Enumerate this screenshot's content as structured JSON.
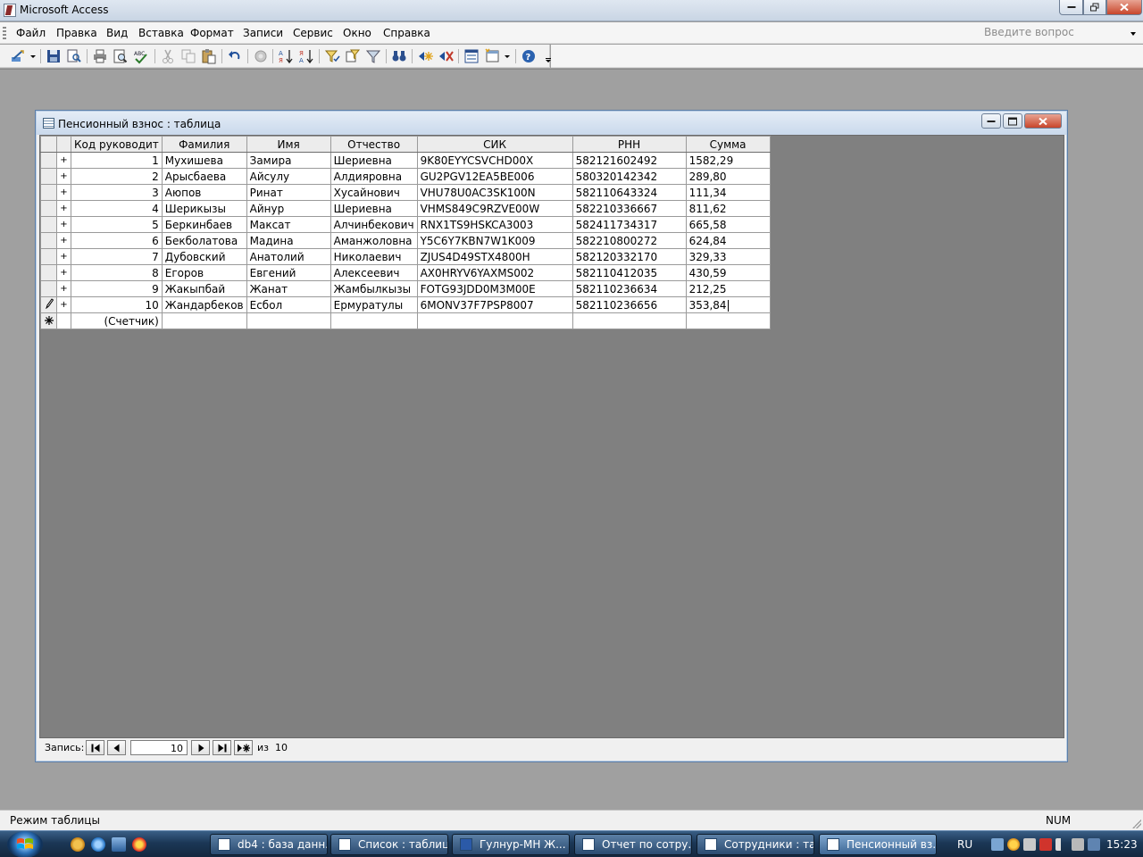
{
  "window": {
    "title": "Microsoft Access"
  },
  "menu": {
    "items": [
      "Файл",
      "Правка",
      "Вид",
      "Вставка",
      "Формат",
      "Записи",
      "Сервис",
      "Окно",
      "Справка"
    ],
    "ask_placeholder": "Введите вопрос"
  },
  "table_window": {
    "title": "Пенсионный взнос : таблица",
    "columns": [
      "Код руководит",
      "Фамилия",
      "Имя",
      "Отчество",
      "СИК",
      "РНН",
      "Сумма"
    ],
    "rows": [
      [
        "1",
        "Мухишева",
        "Замира",
        "Шериевна",
        "9K80EYYCSVCHD00X",
        "582121602492",
        "1582,29"
      ],
      [
        "2",
        "Арысбаева",
        "Айсулу",
        "Алдияровна",
        "GU2PGV12EA5BE006",
        "580320142342",
        "289,80"
      ],
      [
        "3",
        "Аюпов",
        "Ринат",
        "Хусайнович",
        "VHU78U0AC3SK100N",
        "582110643324",
        "111,34"
      ],
      [
        "4",
        "Шерикызы",
        "Айнур",
        "Шериевна",
        "VHMS849C9RZVE00W",
        "582210336667",
        "811,62"
      ],
      [
        "5",
        "Беркинбаев",
        "Максат",
        "Алчинбекович",
        "RNX1TS9HSKCA3003",
        "582411734317",
        "665,58"
      ],
      [
        "6",
        "Бекболатова",
        "Мадина",
        "Аманжоловна",
        "Y5C6Y7KBN7W1K009",
        "582210800272",
        "624,84"
      ],
      [
        "7",
        "Дубовский",
        "Анатолий",
        "Николаевич",
        "ZJUS4D49STX4800H",
        "582120332170",
        "329,33"
      ],
      [
        "8",
        "Егоров",
        "Евгений",
        "Алексеевич",
        "AX0HRYV6YAXMS002",
        "582110412035",
        "430,59"
      ],
      [
        "9",
        "Жакыпбай",
        "Жанат",
        "Жамбылкызы",
        "FOTG93JDD0M3M00E",
        "582110236634",
        "212,25"
      ],
      [
        "10",
        "Жандарбеков",
        "Есбол",
        "Ермуратулы",
        "6MONV37F7PSP8007",
        "582110236656",
        "353,84"
      ]
    ],
    "new_row_placeholder": "(Счетчик)",
    "nav": {
      "label": "Запись:",
      "current": "10",
      "of_label": "из",
      "total": "10"
    }
  },
  "status": {
    "text": "Режим таблицы",
    "num": "NUM"
  },
  "taskbar": {
    "tasks": [
      "db4 : база данн...",
      "Список : таблица",
      "Гулнур-МН Ж...",
      "Отчет по сотру...",
      "Сотрудники : та...",
      "Пенсионный вз..."
    ],
    "lang": "RU",
    "clock": "15:23"
  }
}
